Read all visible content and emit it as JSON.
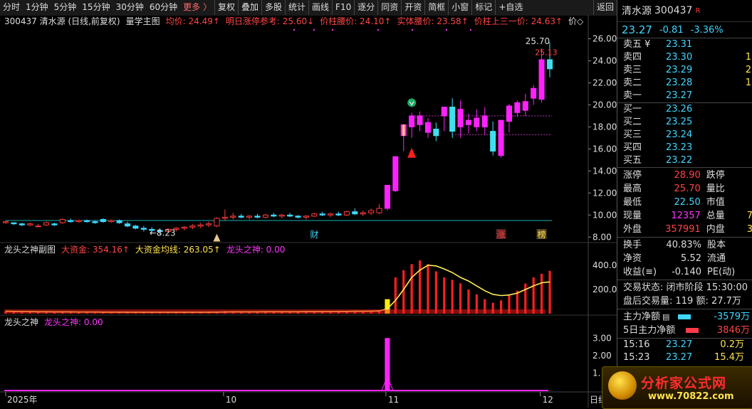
{
  "toolbar": {
    "items": [
      "分时",
      "1分钟",
      "5分钟",
      "15分钟",
      "30分钟",
      "60分钟",
      "更多 〉",
      "复权",
      "叠加",
      "多股",
      "统计",
      "画线",
      "F10",
      "逐分",
      "同资",
      "开资",
      "简框",
      "小窗",
      "标记",
      "+自选"
    ],
    "back": "返回"
  },
  "main_panel": {
    "title": "300437 清水源 (日线,前复权)",
    "indicator_name": "量学主图",
    "labels": [
      {
        "text": "均价: 24.49↑",
        "color": "#ff4545"
      },
      {
        "text": "明日涨停参考: 25.60↓",
        "color": "#ff4545"
      },
      {
        "text": "价柱腰价: 24.10↑",
        "color": "#ff4545"
      },
      {
        "text": "实体腰价: 23.58↑",
        "color": "#ff4545"
      },
      {
        "text": "价柱上三一价: 24.63↑",
        "color": "#ff4545"
      },
      {
        "text": "价◇",
        "color": "#ddd"
      }
    ],
    "y_ticks": [
      "26.00",
      "24.00",
      "22.00",
      "20.00",
      "18.00",
      "16.00",
      "14.00",
      "12.00",
      "10.00",
      "8.00"
    ],
    "annotations": {
      "high": "25.70",
      "low": "←8.23",
      "last": "25.13"
    },
    "markers": [
      "财",
      "涨",
      "榜"
    ]
  },
  "sub_panel1": {
    "name": "龙头之神副图",
    "labels": [
      {
        "text": "大资金: 354.16↑",
        "color": "#ff4545"
      },
      {
        "text": "大资金均线: 263.05↑",
        "color": "#ffe24d"
      },
      {
        "text": "龙头之神: 0.00",
        "color": "#ff33ff"
      }
    ],
    "y_ticks": [
      "400.0",
      "200.0"
    ]
  },
  "sub_panel2": {
    "name": "龙头之神",
    "labels": [
      {
        "text": "龙头之神: 0.00",
        "color": "#ff33ff"
      }
    ],
    "y_ticks": [
      "3.00",
      "2.00",
      "1."
    ]
  },
  "x_axis": {
    "labels": [
      "2025年",
      "10",
      "11",
      "12"
    ],
    "right_label": "日线"
  },
  "quote": {
    "name": "清水源",
    "code": "300437",
    "flag": "R",
    "price": "23.27",
    "change": "-0.81",
    "change_pct": "-3.36%",
    "asks": [
      {
        "label": "卖五 ¥",
        "price": "23.31",
        "vol": ""
      },
      {
        "label": "卖四",
        "price": "23.30",
        "vol": "1"
      },
      {
        "label": "卖三",
        "price": "23.29",
        "vol": "2"
      },
      {
        "label": "卖二",
        "price": "23.28",
        "vol": "1"
      },
      {
        "label": "卖一",
        "price": "23.27",
        "vol": ""
      }
    ],
    "bids": [
      {
        "label": "买一",
        "price": "23.26",
        "vol": ""
      },
      {
        "label": "买二",
        "price": "23.25",
        "vol": ""
      },
      {
        "label": "买三",
        "price": "23.24",
        "vol": ""
      },
      {
        "label": "买四",
        "price": "23.23",
        "vol": ""
      },
      {
        "label": "买五",
        "price": "23.22",
        "vol": ""
      }
    ],
    "stats": [
      {
        "k1": "涨停",
        "v1": "28.90",
        "c1": "up",
        "k2": "跌停",
        "v2": ""
      },
      {
        "k1": "最高",
        "v1": "25.70",
        "c1": "up",
        "k2": "量比",
        "v2": ""
      },
      {
        "k1": "最低",
        "v1": "22.50",
        "c1": "cy",
        "k2": "市值",
        "v2": ""
      },
      {
        "k1": "现量",
        "v1": "12357",
        "c1": "mg",
        "k2": "总量",
        "v2": "7"
      },
      {
        "k1": "外盘",
        "v1": "357991",
        "c1": "up",
        "k2": "内盘",
        "v2": "3"
      }
    ],
    "stats2": [
      {
        "k1": "换手",
        "v1": "40.83%",
        "k2": "股本"
      },
      {
        "k1": "净资",
        "v1": "5.52",
        "k2": "流通"
      },
      {
        "k1": "收益(≡)",
        "v1": "-0.140",
        "k2": "PE(动)"
      }
    ],
    "trade_status": "交易状态: 闭市阶段 15:30:00",
    "after_hours": "盘后交易量: 119  额: 27.7万",
    "flows": [
      {
        "label": "主力净额",
        "icon": "▤",
        "color": "#3fd7ff",
        "value": "-3579万",
        "vcolor": "#3fd7ff"
      },
      {
        "label": "5日主力净额",
        "icon": "",
        "color": "#ff3b4a",
        "value": "3846万",
        "vcolor": "#ff4545"
      }
    ],
    "ticks": [
      {
        "time": "15:16",
        "price": "23.27",
        "vol": "0.2万"
      },
      {
        "time": "15:23",
        "price": "23.27",
        "vol": "15.4万"
      }
    ]
  },
  "logo": {
    "title": "分析家公式网",
    "url": "www.70822.com"
  },
  "chart_data": {
    "type": "candlestick",
    "ylim": [
      7.5,
      27.0
    ],
    "candles": [
      [
        9.3,
        9.5,
        9.2,
        9.4
      ],
      [
        9.3,
        9.3,
        9.1,
        9.2
      ],
      [
        9.2,
        9.3,
        9.0,
        9.1
      ],
      [
        9.1,
        9.3,
        9.0,
        9.2
      ],
      [
        9.0,
        9.2,
        8.9,
        9.0
      ],
      [
        9.1,
        9.4,
        9.0,
        9.3
      ],
      [
        9.2,
        9.3,
        9.0,
        9.1
      ],
      [
        9.3,
        9.7,
        9.2,
        9.6
      ],
      [
        9.5,
        9.7,
        9.3,
        9.4
      ],
      [
        9.4,
        9.6,
        9.3,
        9.5
      ],
      [
        9.5,
        9.6,
        9.3,
        9.4
      ],
      [
        9.4,
        9.5,
        9.2,
        9.3
      ],
      [
        9.6,
        9.7,
        9.3,
        9.4
      ],
      [
        9.4,
        9.6,
        9.3,
        9.5
      ],
      [
        9.5,
        9.6,
        9.2,
        9.3
      ],
      [
        9.2,
        9.4,
        8.9,
        9.0
      ],
      [
        9.0,
        9.1,
        8.7,
        8.8
      ],
      [
        8.8,
        9.0,
        8.5,
        8.7
      ],
      [
        8.7,
        8.9,
        8.4,
        8.6
      ],
      [
        8.6,
        8.8,
        8.23,
        8.5
      ],
      [
        8.5,
        8.8,
        8.4,
        8.7
      ],
      [
        8.7,
        8.9,
        8.5,
        8.8
      ],
      [
        8.8,
        9.0,
        8.6,
        8.9
      ],
      [
        8.9,
        9.2,
        8.7,
        9.0
      ],
      [
        9.0,
        9.3,
        8.8,
        9.1
      ],
      [
        9.1,
        9.4,
        8.9,
        9.2
      ],
      [
        9.0,
        9.8,
        8.9,
        9.7
      ],
      [
        9.7,
        10.5,
        9.5,
        9.8
      ],
      [
        9.8,
        10.2,
        9.6,
        9.9
      ],
      [
        9.9,
        10.1,
        9.7,
        9.8
      ],
      [
        9.8,
        10.0,
        9.6,
        9.9
      ],
      [
        9.9,
        10.1,
        9.7,
        9.8
      ],
      [
        9.8,
        10.1,
        9.7,
        10.0
      ],
      [
        10.0,
        10.2,
        9.8,
        9.9
      ],
      [
        9.9,
        10.1,
        9.7,
        10.0
      ],
      [
        10.0,
        10.2,
        9.8,
        9.9
      ],
      [
        9.9,
        10.0,
        9.7,
        9.8
      ],
      [
        9.8,
        10.0,
        9.6,
        9.9
      ],
      [
        9.9,
        10.2,
        9.8,
        10.1
      ],
      [
        10.1,
        10.3,
        9.9,
        10.0
      ],
      [
        10.0,
        10.2,
        9.8,
        10.1
      ],
      [
        10.1,
        10.3,
        9.9,
        10.0
      ],
      [
        10.0,
        10.4,
        9.9,
        10.3
      ],
      [
        10.3,
        10.6,
        10.0,
        10.1
      ],
      [
        10.1,
        10.4,
        9.9,
        10.2
      ],
      [
        10.2,
        10.6,
        10.0,
        10.4
      ],
      [
        10.2,
        11.0,
        10.1,
        10.6
      ],
      [
        10.6,
        12.7,
        10.4,
        12.7
      ],
      [
        12.2,
        15.3,
        12.1,
        15.3
      ],
      [
        17.2,
        18.0,
        15.8,
        18.2
      ],
      [
        18.0,
        19.3,
        17.0,
        19.0
      ],
      [
        18.2,
        19.4,
        17.6,
        19.0
      ],
      [
        17.5,
        18.8,
        17.0,
        18.4
      ],
      [
        17.8,
        18.4,
        16.7,
        17.2
      ],
      [
        19.0,
        19.8,
        17.6,
        19.8
      ],
      [
        19.8,
        20.6,
        17.0,
        17.6
      ],
      [
        18.0,
        20.4,
        17.0,
        19.6
      ],
      [
        18.2,
        19.2,
        17.4,
        18.6
      ],
      [
        18.0,
        19.6,
        17.6,
        18.8
      ],
      [
        18.0,
        19.8,
        17.3,
        19.0
      ],
      [
        17.6,
        18.5,
        15.4,
        15.8
      ],
      [
        15.4,
        18.6,
        15.2,
        18.6
      ],
      [
        18.5,
        20.1,
        17.5,
        19.9
      ],
      [
        19.3,
        20.4,
        18.9,
        20.2
      ],
      [
        19.5,
        21.0,
        19.0,
        20.3
      ],
      [
        20.6,
        21.8,
        20.0,
        21.5
      ],
      [
        20.5,
        25.13,
        20.2,
        24.1
      ],
      [
        24.1,
        25.7,
        22.5,
        23.27
      ]
    ],
    "vol": [
      18,
      14,
      12,
      12,
      11,
      13,
      12,
      15,
      14,
      12,
      12,
      11,
      12,
      11,
      11,
      10,
      10,
      10,
      9,
      9,
      10,
      11,
      11,
      12,
      12,
      13,
      16,
      22,
      18,
      17,
      15,
      14,
      15,
      16,
      15,
      15,
      14,
      14,
      16,
      17,
      17,
      18,
      20,
      22,
      21,
      24,
      28,
      120,
      300,
      360,
      410,
      440,
      410,
      350,
      300,
      280,
      250,
      200,
      160,
      120,
      90,
      110,
      150,
      190,
      250,
      300,
      330,
      354.16
    ],
    "vol_ma": [
      20,
      19,
      18,
      17,
      16,
      16,
      15,
      15,
      15,
      14,
      14,
      14,
      13,
      13,
      13,
      12,
      12,
      12,
      12,
      12,
      12,
      12,
      12,
      12,
      12,
      12,
      13,
      14,
      15,
      15,
      15,
      15,
      16,
      16,
      16,
      16,
      16,
      17,
      17,
      17,
      18,
      18,
      19,
      20,
      20,
      21,
      23,
      40,
      110,
      200,
      300,
      360,
      400,
      395,
      370,
      340,
      300,
      270,
      230,
      190,
      160,
      150,
      155,
      170,
      200,
      230,
      255,
      263.05
    ],
    "dragon": [
      0,
      0,
      0,
      0,
      0,
      0,
      0,
      0,
      0,
      0,
      0,
      0,
      0,
      0,
      0,
      0,
      0,
      0,
      0,
      0,
      0,
      0,
      0,
      0,
      0,
      0,
      0,
      0,
      0,
      0,
      0,
      0,
      0,
      0,
      0,
      0,
      0,
      0,
      0,
      0,
      0,
      0,
      0,
      0,
      0,
      0,
      0,
      3,
      0,
      0,
      0,
      0,
      0,
      0,
      0,
      0,
      0,
      0,
      0,
      0,
      0,
      0,
      0,
      0,
      0,
      0,
      0,
      0
    ]
  }
}
